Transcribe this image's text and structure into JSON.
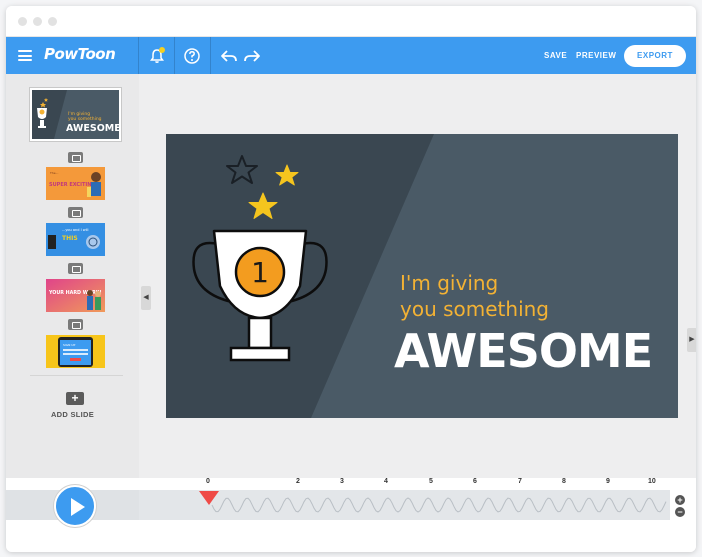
{
  "app": {
    "logo_text": "PowToon"
  },
  "topbar": {
    "save_label": "SAVE",
    "preview_label": "PREVIEW",
    "export_label": "EXPORT"
  },
  "sidebar": {
    "add_slide_label": "ADD SLIDE",
    "thumbnails": [
      {
        "line1": "I'm giving",
        "line2": "you something",
        "title": "AWESOME"
      },
      {
        "line1": "The...",
        "title": "SUPER EXCITING"
      },
      {
        "line1": "...you and I will",
        "title": "THIS"
      },
      {
        "title": "YOUR HARD WORK!"
      },
      {
        "title": "SIGN UP"
      }
    ]
  },
  "slide": {
    "line1": "I'm giving",
    "line2": "you something",
    "title": "AWESOME",
    "trophy_number": "1"
  },
  "timeline": {
    "ticks": [
      "0",
      "2",
      "3",
      "4",
      "5",
      "6",
      "7",
      "8",
      "9",
      "10"
    ],
    "zoom_in": "+",
    "zoom_out": "−"
  },
  "colors": {
    "accent": "#3d9bf0",
    "slide_bg": "#4a5a66",
    "slide_dark": "#3a4751",
    "gold": "#f3b234",
    "playhead": "#ef4b47"
  }
}
